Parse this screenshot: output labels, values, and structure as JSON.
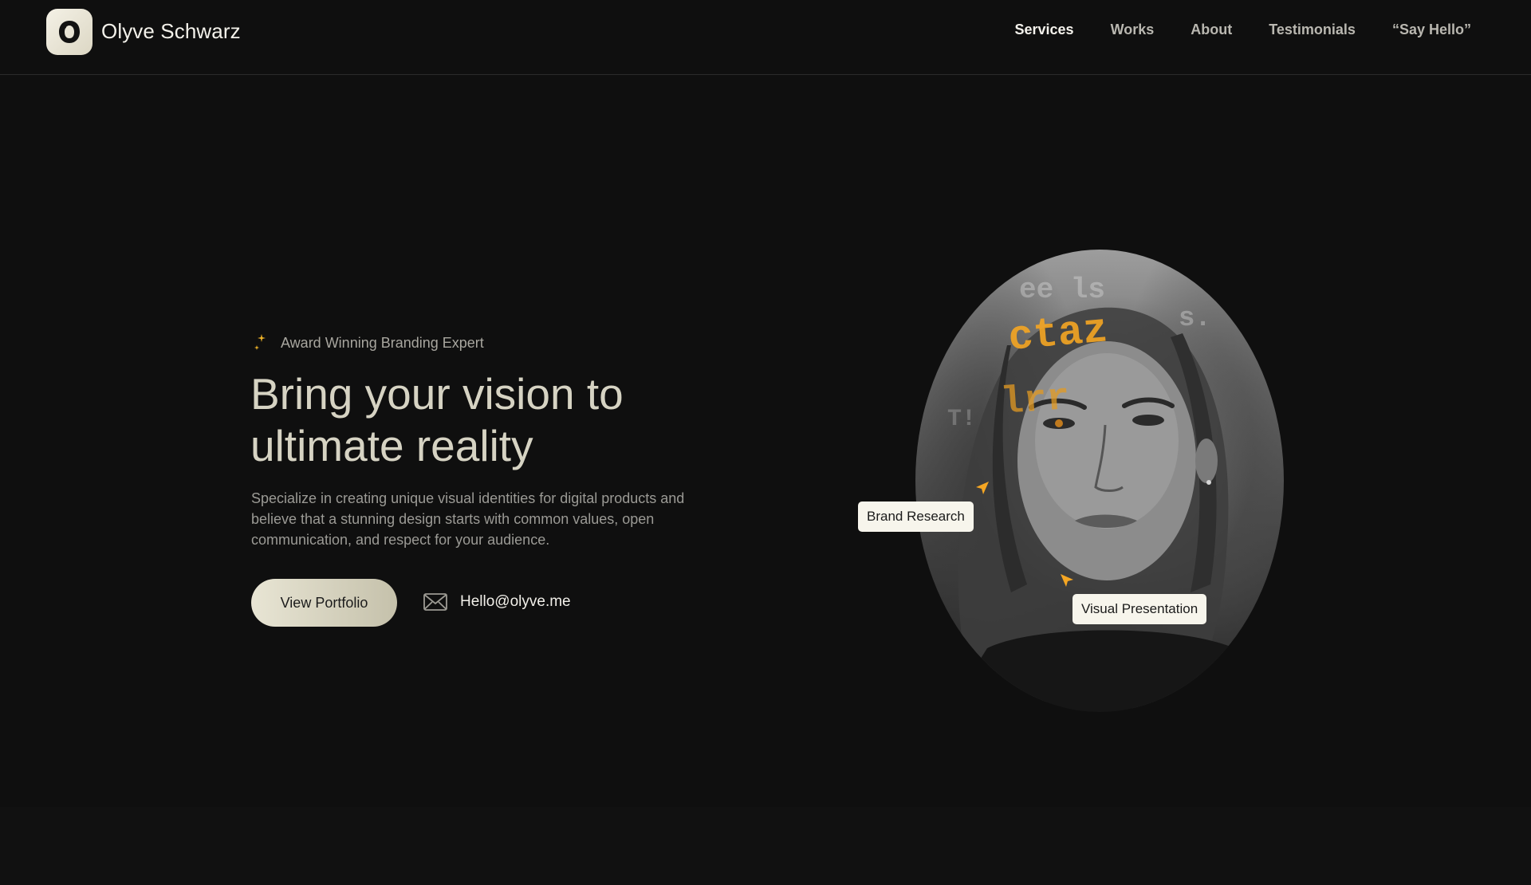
{
  "header": {
    "brand_name": "Olyve Schwarz",
    "nav": [
      {
        "label": "Services",
        "active": true
      },
      {
        "label": "Works",
        "active": false
      },
      {
        "label": "About",
        "active": false
      },
      {
        "label": "Testimonials",
        "active": false
      },
      {
        "label": "“Say Hello”",
        "active": false
      }
    ]
  },
  "hero": {
    "eyebrow": "Award Winning Branding Expert",
    "headline_line1": "Bring your vision to",
    "headline_line2": "ultimate reality",
    "description": "Specialize in creating unique visual identities for digital products and believe that a stunning design starts with common values, open communication, and respect for your audience.",
    "cta_label": "View Portfolio",
    "email": "Hello@olyve.me"
  },
  "portrait": {
    "tags": [
      "Brand Research",
      "Visual Presentation"
    ]
  },
  "icons": {
    "logo": "logo-mark-icon",
    "eyebrow": "sparkle-icon",
    "email": "envelope-icon",
    "tag_pointer": "cursor-arrow-icon"
  },
  "colors": {
    "background": "#0f0f0f",
    "accent_gold": "#f5a623",
    "button_gradient_start": "#e8e5d4",
    "button_gradient_end": "#c5c1ab"
  }
}
